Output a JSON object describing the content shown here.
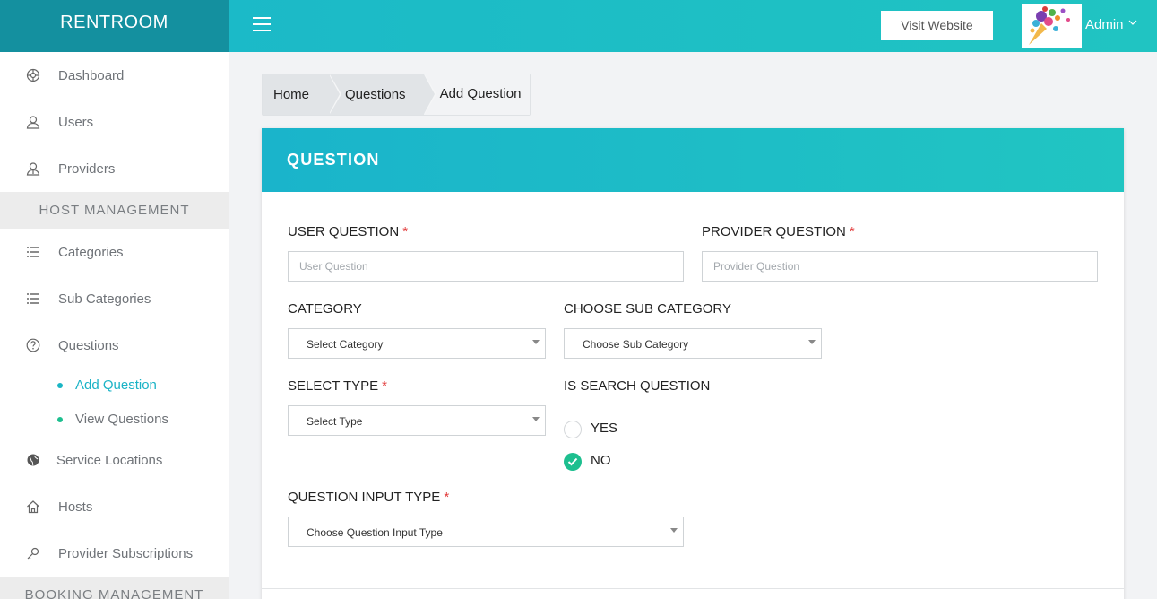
{
  "app": {
    "brand": "RENTROOM"
  },
  "topbar": {
    "visit_website": "Visit Website",
    "user_name": "Admin"
  },
  "sidebar": {
    "items": [
      {
        "label": "Dashboard",
        "icon": "dashboard-icon"
      },
      {
        "label": "Users",
        "icon": "user-icon"
      },
      {
        "label": "Providers",
        "icon": "provider-icon"
      }
    ],
    "section_host": "HOST MANAGEMENT",
    "host_items": [
      {
        "label": "Categories",
        "icon": "list-icon"
      },
      {
        "label": "Sub Categories",
        "icon": "list-icon"
      },
      {
        "label": "Questions",
        "icon": "question-icon"
      }
    ],
    "question_subitems": [
      {
        "label": "Add Question",
        "active": true
      },
      {
        "label": "View Questions",
        "active": false
      }
    ],
    "more_items": [
      {
        "label": "Service Locations",
        "icon": "globe-icon"
      },
      {
        "label": "Hosts",
        "icon": "home-icon"
      },
      {
        "label": "Provider Subscriptions",
        "icon": "key-icon"
      }
    ],
    "section_booking": "BOOKING MANAGEMENT"
  },
  "breadcrumb": [
    "Home",
    "Questions",
    "Add Question"
  ],
  "card": {
    "title": "QUESTION",
    "user_question": {
      "label": "USER QUESTION",
      "required": "*",
      "placeholder": "User Question",
      "value": ""
    },
    "provider_question": {
      "label": "PROVIDER QUESTION",
      "required": "*",
      "placeholder": "Provider Question",
      "value": ""
    },
    "category": {
      "label": "CATEGORY",
      "selected": "Select Category"
    },
    "sub_category": {
      "label": "CHOOSE SUB CATEGORY",
      "selected": "Choose Sub Category"
    },
    "type": {
      "label": "SELECT TYPE",
      "required": "*",
      "selected": "Select Type"
    },
    "is_search": {
      "label": "IS SEARCH QUESTION",
      "options": [
        "YES",
        "NO"
      ],
      "selected": "NO"
    },
    "input_type": {
      "label": "QUESTION INPUT TYPE",
      "required": "*",
      "selected": "Choose Question Input Type"
    }
  },
  "colors": {
    "accent": "#1ab7c9",
    "brand_bg": "#14909f",
    "radio_checked": "#1dbf8f",
    "required": "#e23b3b"
  }
}
